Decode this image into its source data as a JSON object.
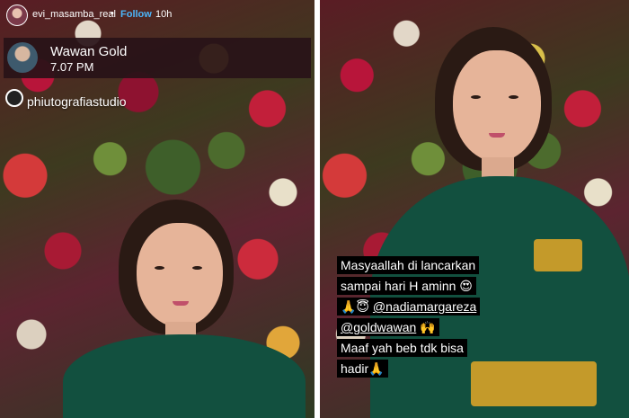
{
  "story": {
    "username": "evi_masamba_real",
    "separator": "•",
    "follow_label": "Follow",
    "time": "10h"
  },
  "inner_post": {
    "name": "Wawan Gold",
    "time": "7.07 PM",
    "photo_credit": "phiutografiastudio"
  },
  "caption": {
    "line1": "Masyaallah di lancarkan",
    "line2": "sampai hari H aminn 😍",
    "line3_emoji": "🙏😇",
    "line3_mention": "@nadiamargareza",
    "line4_mention": "@goldwawan",
    "line4_emoji": "🙌",
    "line5": "Maaf yah beb tdk bisa",
    "line6": "hadir🙏"
  },
  "icons": {
    "more": "more-horizontal-icon",
    "avatar": "profile-avatar-icon",
    "studio": "camera-studio-icon"
  },
  "colors": {
    "follow_blue": "#4cb5f9",
    "dress_green": "#12503f",
    "caption_bg": "#000000"
  }
}
